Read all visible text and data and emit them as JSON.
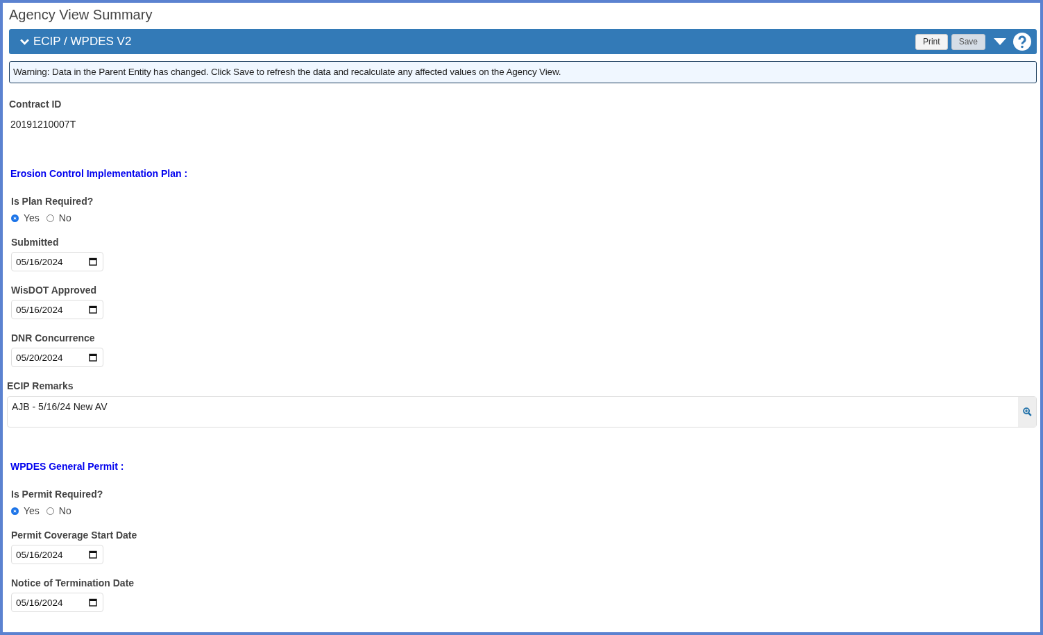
{
  "page_title": "Agency View Summary",
  "panel": {
    "title": "ECIP / WPDES V2",
    "expanded": true,
    "buttons": [
      {
        "label": "Print",
        "disabled": false
      },
      {
        "label": "Save",
        "disabled": true
      }
    ]
  },
  "warning": "Warning: Data in the Parent Entity has changed. Click Save to refresh the data and recalculate any affected values on the Agency View.",
  "contract": {
    "label": "Contract ID",
    "value": "20191210007T"
  },
  "sections": [
    {
      "heading": "Erosion Control Implementation Plan :",
      "fields": [
        {
          "kind": "radio",
          "label": "Is Plan Required?",
          "options": [
            {
              "label": "Yes",
              "selected": true
            },
            {
              "label": "No",
              "selected": false
            }
          ]
        },
        {
          "kind": "date",
          "label": "Submitted",
          "value": "05/16/2024"
        },
        {
          "kind": "date",
          "label": "WisDOT Approved",
          "value": "05/16/2024"
        },
        {
          "kind": "date",
          "label": "DNR Concurrence",
          "value": "05/20/2024"
        },
        {
          "kind": "remarks",
          "label": "ECIP Remarks",
          "value": "AJB - 5/16/24 New AV"
        }
      ]
    },
    {
      "heading": "WPDES General Permit :",
      "fields": [
        {
          "kind": "radio",
          "label": "Is Permit Required?",
          "options": [
            {
              "label": "Yes",
              "selected": true
            },
            {
              "label": "No",
              "selected": false
            }
          ]
        },
        {
          "kind": "date",
          "label": "Permit Coverage Start Date",
          "value": "05/16/2024"
        },
        {
          "kind": "date",
          "label": "Notice of Termination Date",
          "value": "05/16/2024"
        }
      ]
    }
  ]
}
